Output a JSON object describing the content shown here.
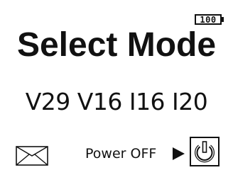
{
  "status": {
    "battery_level": "100"
  },
  "screen": {
    "title": "Select Mode",
    "modes_line": "V29 V16 I16 I20"
  },
  "footer": {
    "power_label": "Power OFF",
    "envelope_icon": "envelope-icon",
    "arrow_icon": "right-triangle-icon",
    "power_icon": "power-icon"
  },
  "colors": {
    "foreground": "#111111",
    "background": "#ffffff"
  }
}
